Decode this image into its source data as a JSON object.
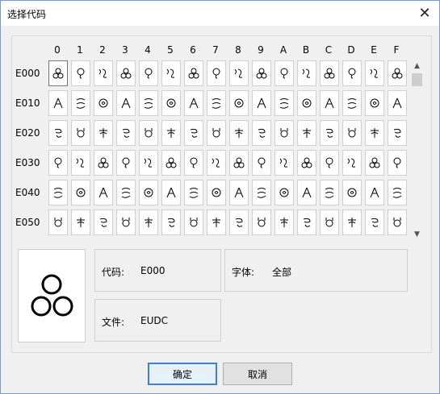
{
  "window": {
    "title": "选择代码",
    "close_symbol": "✕"
  },
  "grid": {
    "columns": [
      "0",
      "1",
      "2",
      "3",
      "4",
      "5",
      "6",
      "7",
      "8",
      "9",
      "A",
      "B",
      "C",
      "D",
      "E",
      "F"
    ],
    "rows": [
      "E000",
      "E010",
      "E020",
      "E030",
      "E040",
      "E050"
    ],
    "selected": {
      "row": 0,
      "col": 0
    }
  },
  "scrollbar": {
    "up_symbol": "▲",
    "down_symbol": "▼"
  },
  "info": {
    "code_label": "代码:",
    "code_value": "E000",
    "font_label": "字体:",
    "font_value": "全部",
    "file_label": "文件:",
    "file_value": "EUDC"
  },
  "buttons": {
    "ok_label": "确定",
    "cancel_label": "取消"
  },
  "colors": {
    "accent": "#3c7fd6",
    "window_border": "#7a9bc7"
  }
}
